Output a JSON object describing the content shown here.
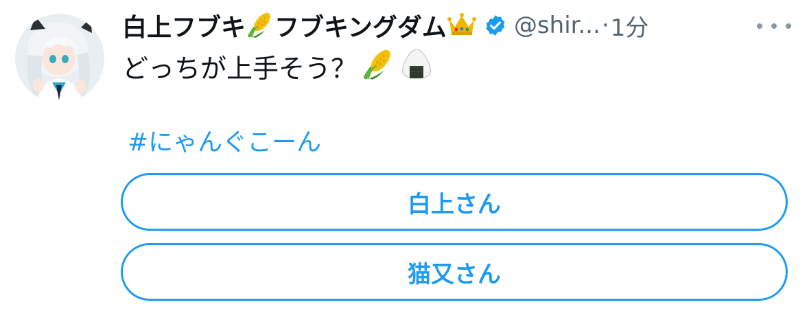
{
  "tweet": {
    "author": {
      "display_name": "白上フブキ🌽フブキングダム👑",
      "display_name_parts": {
        "name": "白上フブキ",
        "suffix": "フブキングダム"
      },
      "emojis": [
        "corn-emoji",
        "crown-emoji"
      ],
      "verified": true,
      "handle": "@shir...",
      "avatar_icon": "avatar-anime-girl"
    },
    "separator": "·",
    "time": "1分",
    "text": "どっちが上手そう？",
    "text_emojis": [
      "corn-emoji",
      "onigiri-emoji"
    ],
    "hashtag": "#にゃんぐこーん",
    "poll": {
      "options": [
        {
          "label": "白上さん"
        },
        {
          "label": "猫又さん"
        }
      ]
    },
    "more_icon": "more-icon"
  },
  "colors": {
    "accent": "#1d9bf0",
    "text": "#0f1419",
    "secondary": "#536471"
  }
}
